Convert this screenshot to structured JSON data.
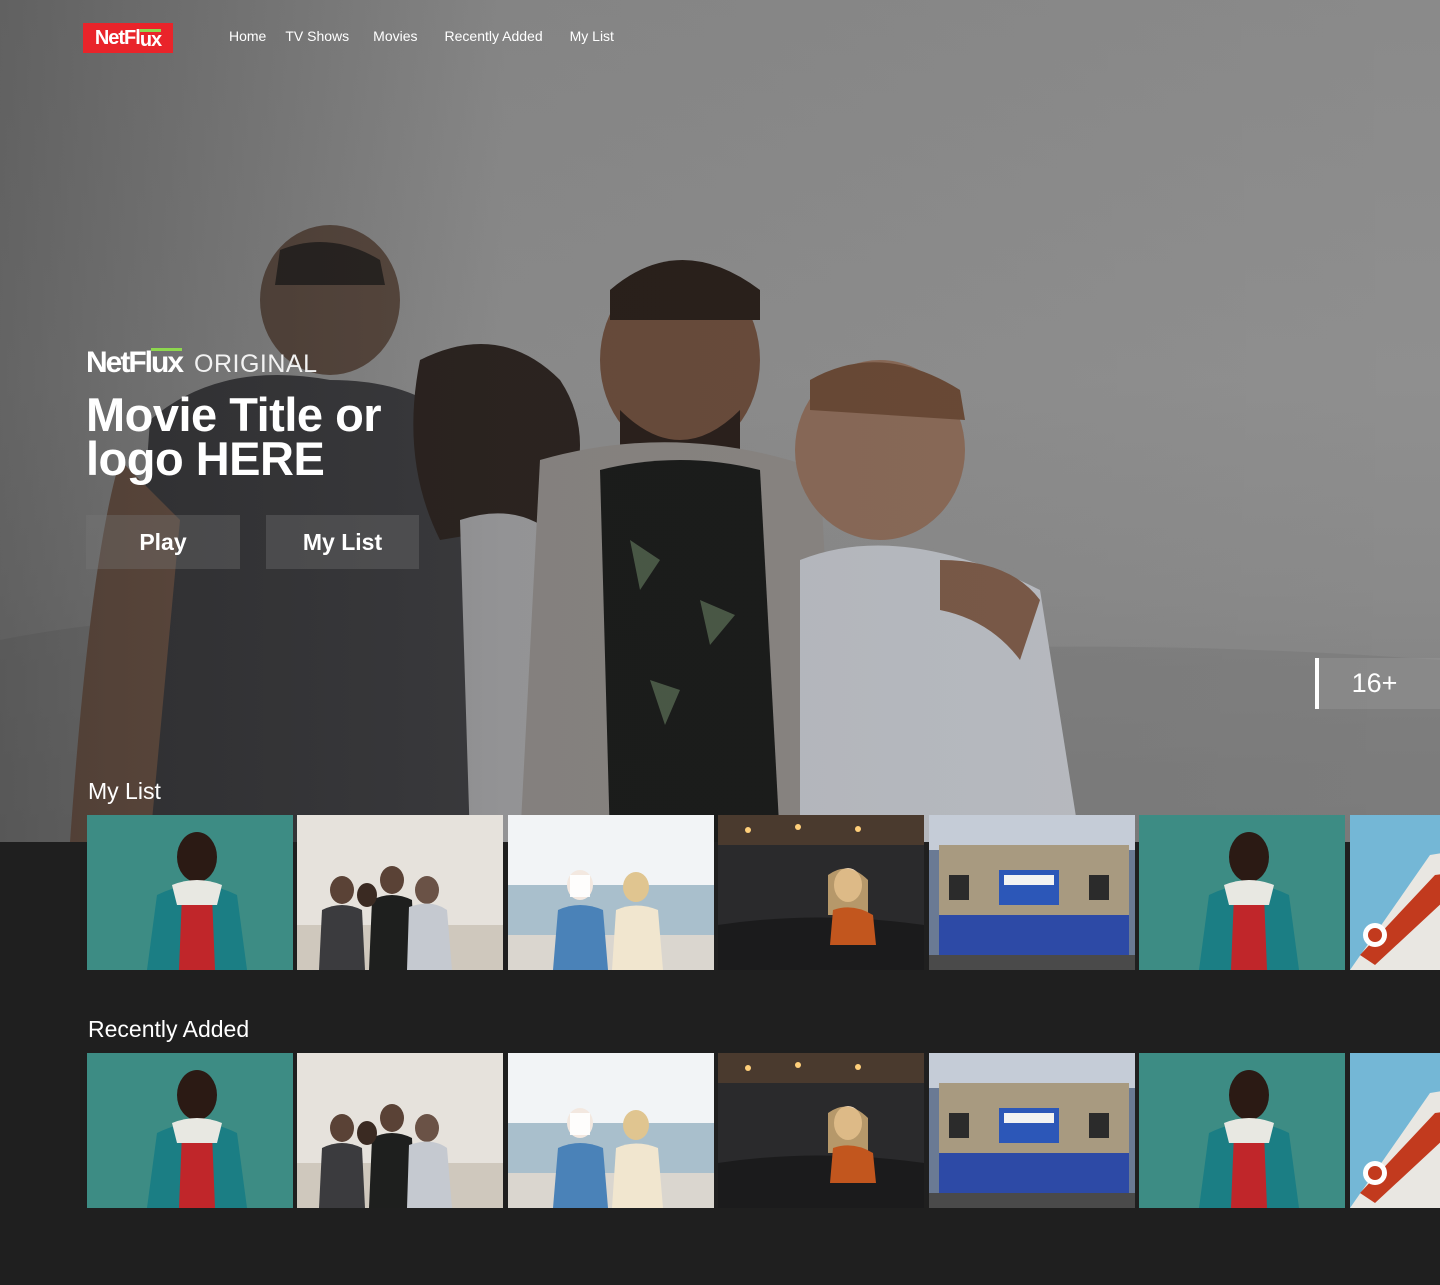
{
  "brand": {
    "logo_text_pre": "NetFl",
    "logo_text_ux": "ux",
    "logo_color": "#e9242a",
    "logo_accent": "#8dd84e"
  },
  "nav": {
    "items": [
      {
        "label": "Home"
      },
      {
        "label": "TV Shows"
      },
      {
        "label": "Movies"
      },
      {
        "label": "Recently Added"
      },
      {
        "label": "My List"
      }
    ]
  },
  "hero": {
    "original_label": "ORIGINAL",
    "title": "Movie Title or logo HERE",
    "play_label": "Play",
    "mylist_label": "My List",
    "rating": "16+"
  },
  "rows": [
    {
      "title": "My List",
      "tiles": [
        {
          "icon": "man-teal-jacket-photo"
        },
        {
          "icon": "friends-laughing-photo"
        },
        {
          "icon": "women-beach-photo"
        },
        {
          "icon": "woman-cinema-photo"
        },
        {
          "icon": "theater-building-photo"
        },
        {
          "icon": "man-teal-jacket-photo"
        },
        {
          "icon": "cinema-sign-photo"
        }
      ]
    },
    {
      "title": "Recently Added",
      "tiles": [
        {
          "icon": "man-teal-jacket-photo"
        },
        {
          "icon": "friends-laughing-photo"
        },
        {
          "icon": "women-beach-photo"
        },
        {
          "icon": "woman-cinema-photo"
        },
        {
          "icon": "theater-building-photo"
        },
        {
          "icon": "man-teal-jacket-photo"
        },
        {
          "icon": "cinema-sign-photo"
        }
      ]
    }
  ]
}
